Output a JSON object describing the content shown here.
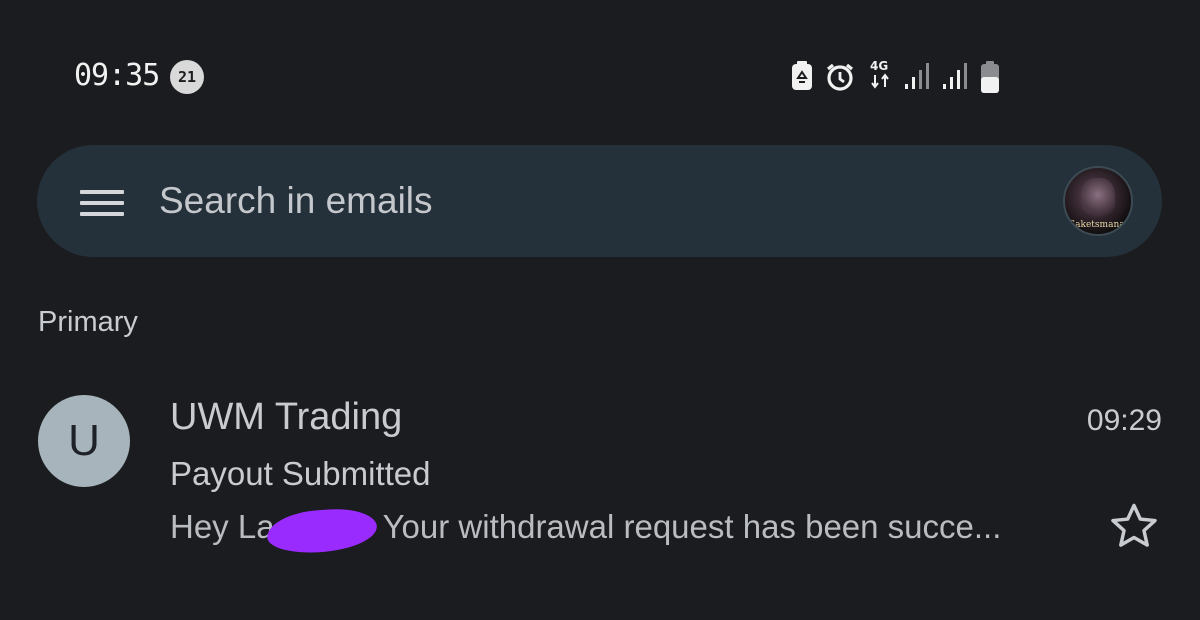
{
  "status_bar": {
    "time": "09:35",
    "notification_count": "21",
    "network_type": "4G",
    "icons": [
      "battery-saver-icon",
      "alarm-icon",
      "data-arrows-icon",
      "signal-icon",
      "signal-icon",
      "battery-icon"
    ]
  },
  "search": {
    "placeholder": "Search in emails"
  },
  "account": {
    "avatar_caption": "SaketsmanaB"
  },
  "inbox": {
    "section_label": "Primary",
    "emails": [
      {
        "avatar_letter": "U",
        "sender": "UWM Trading",
        "time": "09:29",
        "subject": "Payout Submitted",
        "snippet_start": "Hey La",
        "snippet_end": "Your withdrawal request has been succe..."
      }
    ]
  },
  "colors": {
    "background": "#1b1c1f",
    "search_bar": "#25313a",
    "sender_avatar": "#a7b4bc",
    "redaction": "#9a2bff"
  }
}
